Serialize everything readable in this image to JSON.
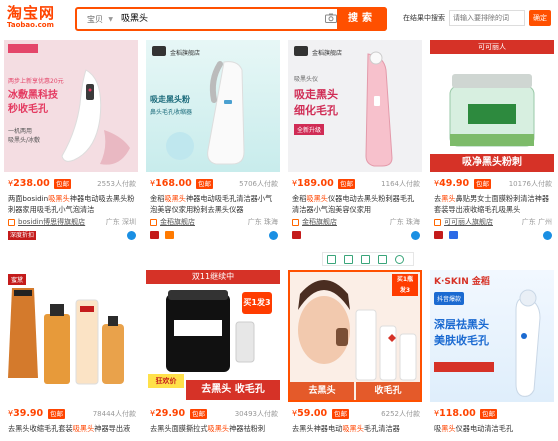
{
  "header": {
    "logo_cn": "淘宝网",
    "logo_en": "Taobao.com",
    "search_scope": "宝贝",
    "search_query": "吸黑头",
    "search_button": "搜索",
    "within_label": "在结果中搜索",
    "within_placeholder": "请输入要排除的词",
    "within_button": "确定"
  },
  "colors": {
    "accent": "#ff5000",
    "price": "#ff4400"
  },
  "products": [
    {
      "price": "238.00",
      "badge": "包邮",
      "sold": "2553人付款",
      "title_prefix": "两面bosidin",
      "title_kw": "吸黑头",
      "title_rest": "神器电动吸去黑头粉刺器家用吸毛孔小气泡清洁",
      "shop": "bosidin博思得旗舰店",
      "location": "广东 深圳",
      "tag": "深度折扣",
      "img_texts": [
        "两步上新享优惠20元",
        "冰敷黑科技",
        "秒收毛孔",
        "一机两用",
        "吸黑头/冰敷"
      ]
    },
    {
      "price": "168.00",
      "badge": "包邮",
      "sold": "5706人付款",
      "title_prefix": "金稻",
      "title_kw": "吸黑头",
      "title_rest": "神器电动吸毛孔清洁器小气泡美容仪家用粉刺去黑头仪器",
      "shop": "金稻旗舰店",
      "location": "广东 珠海",
      "tag": "",
      "img_texts": [
        "金稻旗舰店",
        "吸走黑头粉",
        "鼻头毛孔收缩器"
      ]
    },
    {
      "price": "189.00",
      "badge": "包邮",
      "sold": "1164人付款",
      "title_prefix": "金稻",
      "title_kw": "吸黑头",
      "title_rest": "仪器电动去黑头粉刺器毛孔清洁器小气泡美容仪家用",
      "shop": "金稻旗舰店",
      "location": "广东 珠海",
      "tag": "",
      "img_texts": [
        "金稻旗舰店",
        "吸黑头仪",
        "吸走黑头",
        "细化毛孔",
        "全新升级"
      ]
    },
    {
      "price": "49.90",
      "badge": "包邮",
      "sold": "10176人付款",
      "title_prefix": "去",
      "title_kw": "黑头",
      "title_rest": "鼻贴男女士面膜粉刺清洁神器套装导出液收缩毛孔吸黑头",
      "shop": "可可丽人旗舰店",
      "location": "广东 广州",
      "tag": "",
      "img_texts": [
        "可可丽人",
        "吸净黑头粉刺"
      ]
    },
    {
      "price": "39.90",
      "badge": "包邮",
      "sold": "78444人付款",
      "title_prefix": "去黑头收缩毛孔套装",
      "title_kw": "吸黑头",
      "title_rest": "神器导出液鼻贴清洁男女士",
      "shop": "",
      "location": "",
      "tag": "",
      "img_texts": [
        "蜜黛"
      ]
    },
    {
      "price": "29.90",
      "badge": "包邮",
      "sold": "30493人付款",
      "title_prefix": "去黑头面膜撕拉式",
      "title_kw": "吸黑头",
      "title_rest": "神器祛粉刺",
      "shop": "",
      "location": "",
      "tag": "",
      "img_texts": [
        "双11继续中",
        "买1发3",
        "狂欢价",
        "去黑头 收毛孔"
      ]
    },
    {
      "price": "59.00",
      "badge": "包邮",
      "sold": "6252人付款",
      "title_prefix": "去黑头神器电动",
      "title_kw": "吸黑头",
      "title_rest": "毛孔清洁器",
      "shop": "",
      "location": "",
      "tag": "",
      "img_texts": [
        "买1瓶",
        "发3",
        "去黑头",
        "收毛孔"
      ]
    },
    {
      "price": "118.00",
      "badge": "包邮",
      "sold": "",
      "title_prefix": "吸",
      "title_kw": "黑头",
      "title_rest": "仪器电动清洁毛孔",
      "shop": "",
      "location": "",
      "tag": "",
      "img_texts": [
        "K·SKIN 金稻",
        "抖音爆款",
        "深层祛黑头",
        "美肤收毛孔"
      ]
    }
  ]
}
